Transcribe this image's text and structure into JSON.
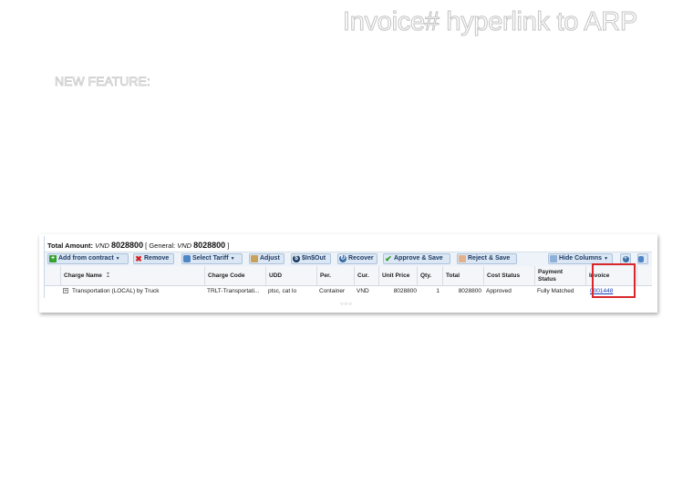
{
  "slide": {
    "title": "Invoice# hyperlink to ARP",
    "subtitle": "NEW FEATURE:"
  },
  "summary": {
    "label": "Total Amount:",
    "currency": "VND",
    "amount": "8028800",
    "general_open": "[ General:",
    "general_currency": "VND",
    "general_amount": "8028800",
    "general_close": "]"
  },
  "toolbar": {
    "add_from_contract": "Add from contract",
    "remove": "Remove",
    "select_tariff": "Select Tariff",
    "adjust": "Adjust",
    "in_out": "$In$Out",
    "recover": "Recover",
    "approve_save": "Approve & Save",
    "reject_save": "Reject & Save",
    "hide_columns": "Hide Columns"
  },
  "columns": {
    "charge_name": "Charge Name",
    "charge_code": "Charge Code",
    "udd": "UDD",
    "per": "Per.",
    "cur": "Cur.",
    "unit_price": "Unit Price",
    "qty": "Qty.",
    "total": "Total",
    "cost_status": "Cost Status",
    "payment_status": "Payment Status",
    "invoice": "Invoice"
  },
  "rows": [
    {
      "expander": "+",
      "charge_name": "Transportation (LOCAL) by Truck",
      "charge_code": "TRLT-Transportati...",
      "udd": "ptsc, cat lo",
      "per": "Container",
      "cur": "VND",
      "unit_price": "8028800",
      "qty": "1",
      "total": "8028800",
      "cost_status": "Approved",
      "payment_status": "Fully Matched",
      "invoice": "0001448"
    }
  ],
  "icons": {
    "add": "plus-icon",
    "remove": "x-icon",
    "tariff": "tariff-icon",
    "adjust": "adjust-icon",
    "inout": "dollar-icon",
    "recover": "recover-icon",
    "approve": "check-icon",
    "reject": "reject-icon",
    "columns": "columns-icon"
  },
  "colors": {
    "highlight_border": "#d8262a",
    "link": "#1a3fb5",
    "toolbar_bg": "#eef3f9"
  }
}
